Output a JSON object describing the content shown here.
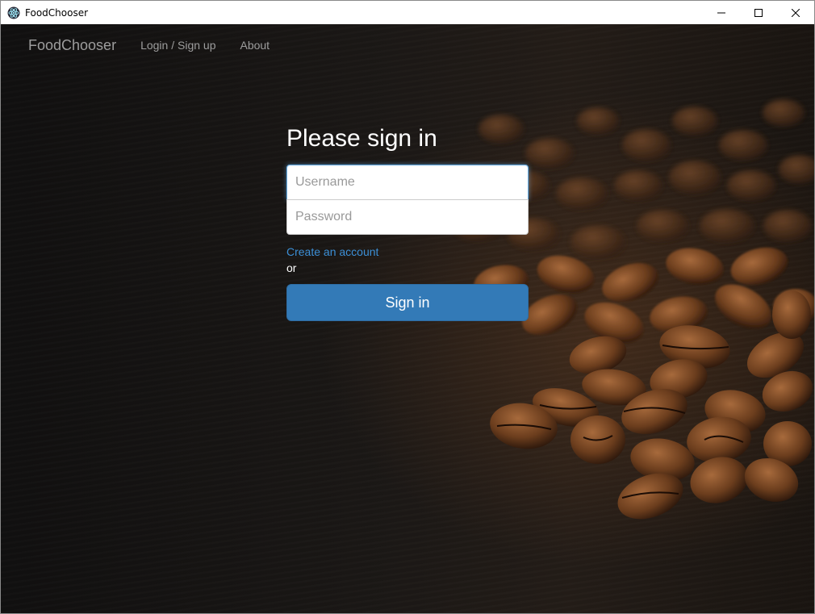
{
  "window": {
    "title": "FoodChooser",
    "icon": "electron-atom-icon",
    "controls": [
      "minimize-icon",
      "maximize-icon",
      "close-icon"
    ]
  },
  "navbar": {
    "brand": "FoodChooser",
    "links": [
      {
        "label": "Login / Sign up"
      },
      {
        "label": "About"
      }
    ]
  },
  "signin": {
    "heading": "Please sign in",
    "username_placeholder": "Username",
    "password_placeholder": "Password",
    "create_account": "Create an account",
    "or": "or",
    "submit_label": "Sign in"
  },
  "colors": {
    "primary_button": "#337ab7",
    "link": "#3c8fd6",
    "nav_text": "#9d9d9d",
    "background": "#1b1816"
  }
}
